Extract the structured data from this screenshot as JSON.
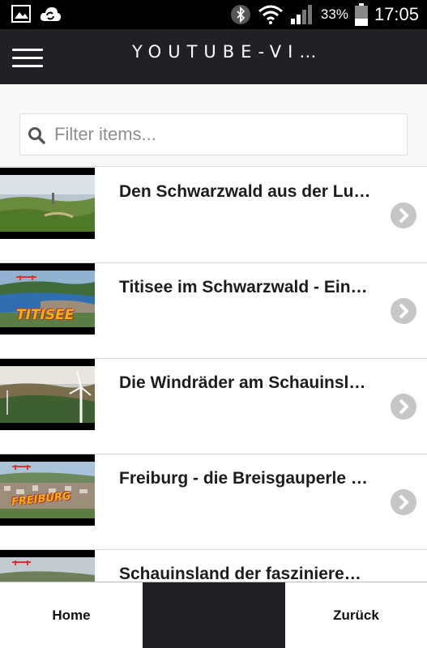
{
  "status_bar": {
    "battery": "33%",
    "time": "17:05",
    "icons": [
      "image-icon",
      "sync-icon",
      "bluetooth-icon",
      "wifi-icon",
      "signal-icon",
      "battery-icon"
    ]
  },
  "app_bar": {
    "title": "YOUTUBE-VI…",
    "menu_icon": "hamburger-menu-icon"
  },
  "search": {
    "placeholder": "Filter items...",
    "value": "",
    "icon": "search-icon"
  },
  "videos": [
    {
      "title": "Den Schwarzwald aus der Lu…"
    },
    {
      "title": "Titisee im Schwarzwald - Ein…",
      "thumb_caption": "TITISEE"
    },
    {
      "title": "Die Windräder am Schauinsl…"
    },
    {
      "title": "Freiburg - die Breisgauperle …",
      "thumb_caption": "FREIBURG"
    },
    {
      "title": "Schauinsland der fasziniere…"
    }
  ],
  "bottom_nav": {
    "home_label": "Home",
    "back_label": "Zurück"
  },
  "colors": {
    "app_bar_bg": "#1f2125",
    "status_bar_bg": "#000000",
    "chevron_bg": "#c6c6c6"
  }
}
